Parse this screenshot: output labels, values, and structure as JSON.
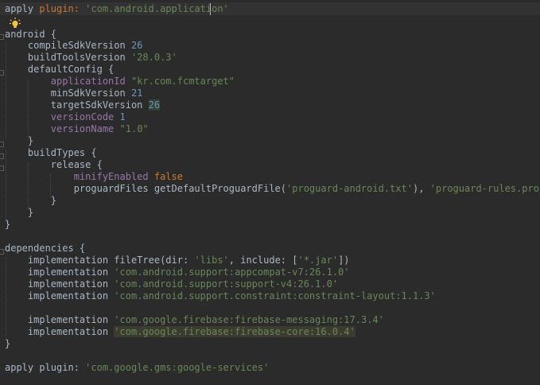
{
  "editor": {
    "theme_colors": {
      "background": "#2b2b2b",
      "text": "#a9b7c6",
      "string": "#6a8759",
      "number": "#6897bb",
      "keyword": "#cc7832",
      "property": "#9876aa"
    },
    "icons": [
      "lightbulb-icon"
    ],
    "code": {
      "l1": {
        "a": "apply",
        "b": " plugin: ",
        "c": "'com.android.application'"
      },
      "l2": {
        "a": "android {"
      },
      "l3": {
        "a": "    compileSdkVersion ",
        "b": "26"
      },
      "l4": {
        "a": "    buildToolsVersion ",
        "b": "'28.0.3'"
      },
      "l5": {
        "a": "    defaultConfig {"
      },
      "l6": {
        "a": "        ",
        "b": "applicationId",
        "c": " ",
        "d": "\"kr.com.fcmtarget\""
      },
      "l7": {
        "a": "        minSdkVersion ",
        "b": "21"
      },
      "l8": {
        "a": "        targetSdkVersion ",
        "b": "26"
      },
      "l9": {
        "a": "        ",
        "b": "versionCode",
        "c": " ",
        "d": "1"
      },
      "l10": {
        "a": "        ",
        "b": "versionName",
        "c": " ",
        "d": "\"1.0\""
      },
      "l11": {
        "a": "    }"
      },
      "l12": {
        "a": "    buildTypes {"
      },
      "l13": {
        "a": "        release {"
      },
      "l14": {
        "a": "            ",
        "b": "minifyEnabled",
        "c": " ",
        "d": "false"
      },
      "l15": {
        "a": "            proguardFiles getDefaultProguardFile(",
        "b": "'proguard-android.txt'",
        "c": "), ",
        "d": "'proguard-rules.pro'"
      },
      "l16": {
        "a": "        }"
      },
      "l17": {
        "a": "    }"
      },
      "l18": {
        "a": "}"
      },
      "l19": {
        "a": "dependencies {"
      },
      "l20": {
        "a": "    implementation fileTree(dir: ",
        "b": "'libs'",
        "c": ", include: [",
        "d": "'*.jar'",
        "e": "])"
      },
      "l21": {
        "a": "    implementation ",
        "b": "'com.android.support:appcompat-v7:26.1.0'"
      },
      "l22": {
        "a": "    implementation ",
        "b": "'com.android.support:support-v4:26.1.0'"
      },
      "l23": {
        "a": "    implementation ",
        "b": "'com.android.support.constraint:constraint-layout:1.1.3'"
      },
      "l24": {
        "a": "    implementation ",
        "b": "'com.google.firebase:firebase-messaging:17.3.4'"
      },
      "l25": {
        "a": "    implementation ",
        "b": "'com.google.firebase:firebase-core:16.0.4'"
      },
      "l26": {
        "a": "}"
      },
      "l27": {
        "a": "apply plugin: ",
        "b": "'com.google.gms:google-services'"
      }
    }
  }
}
